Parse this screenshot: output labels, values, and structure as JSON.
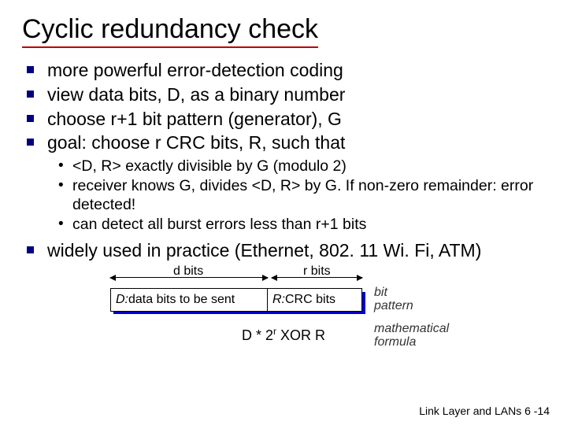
{
  "title": "Cyclic redundancy check",
  "bullets": {
    "b1": "more powerful error-detection coding",
    "b2": "view data bits, D, as a binary number",
    "b3": "choose r+1 bit pattern (generator), G",
    "b4": "goal: choose r CRC bits, R, such that",
    "s1": "<D, R> exactly divisible by G (modulo 2)",
    "s2": "receiver knows G, divides <D, R> by G.  If non-zero remainder: error detected!",
    "s3": "can detect all burst errors less than r+1 bits",
    "b5": "widely used in practice (Ethernet, 802. 11 Wi. Fi, ATM)"
  },
  "diagram": {
    "dbits": "d bits",
    "rbits": "r bits",
    "box1_prefix": "D:",
    "box1_text": " data bits to be sent",
    "box2_prefix": "R:",
    "box2_text": " CRC bits",
    "side1a": "bit",
    "side1b": "pattern",
    "formula_D": "D",
    "formula_times": " * 2",
    "formula_r": "r",
    "formula_xor": "   XOR   R",
    "side2a": "mathematical",
    "side2b": "formula"
  },
  "footer": "Link Layer and LANs  6 -14"
}
